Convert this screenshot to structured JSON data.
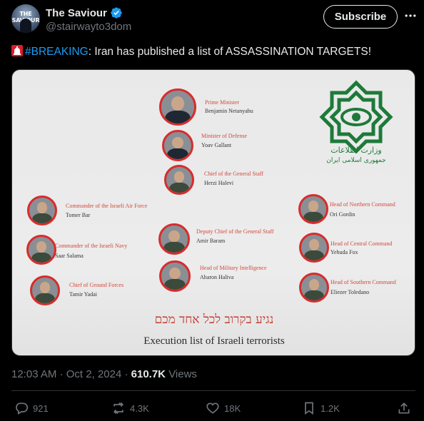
{
  "author": {
    "display_name": "The Saviour",
    "handle": "@stairwayto3dom",
    "avatar_text": "THE SAVIOUR",
    "verified": true
  },
  "subscribe_label": "Subscribe",
  "tweet": {
    "hashtag": "#BREAKING",
    "text": ": Iran has published a list of ASSASSINATION TARGETS!"
  },
  "media": {
    "people": [
      {
        "title": "Prime Minister",
        "name": "Benjamin Netanyahu"
      },
      {
        "title": "Minister of Defense",
        "name": "Yoav Gallant"
      },
      {
        "title": "Chief of the General Staff",
        "name": "Herzi Halevi"
      },
      {
        "title": "Commander of the Israeli Air Force",
        "name": "Tomer Bar"
      },
      {
        "title": "Deputy Chief of the General Staff",
        "name": "Amir Baram"
      },
      {
        "title": "Commander of the Israeli Navy",
        "name": "Saar Salama"
      },
      {
        "title": "Head of Military Intelligence",
        "name": "Aharon Haliva"
      },
      {
        "title": "Chief of Ground Forces",
        "name": "Tamir Yadai"
      },
      {
        "title": "Head of Northern Command",
        "name": "Ori Gordin"
      },
      {
        "title": "Head of Central Command",
        "name": "Yehuda Fox"
      },
      {
        "title": "Head of Southern Command",
        "name": "Eliezer Toledano"
      }
    ],
    "hebrew_text": "נגיע בקרוב לכל אחד מכם",
    "caption": "Execution list of Israeli terrorists",
    "logo_text_line1": "وزارت اطلاعات",
    "logo_text_line2": "جمهوری اسلامی ایران"
  },
  "meta": {
    "time": "12:03 AM",
    "date": "Oct 2, 2024",
    "separator": "·",
    "views_count": "610.7K",
    "views_label": "Views"
  },
  "actions": {
    "replies": "921",
    "reposts": "4.3K",
    "likes": "18K",
    "bookmarks": "1.2K"
  },
  "colors": {
    "background": "#000000",
    "accent": "#1d9bf0",
    "muted": "#71767b",
    "portrait_ring": "#d82c2c",
    "logo_green": "#1e7a3a"
  }
}
